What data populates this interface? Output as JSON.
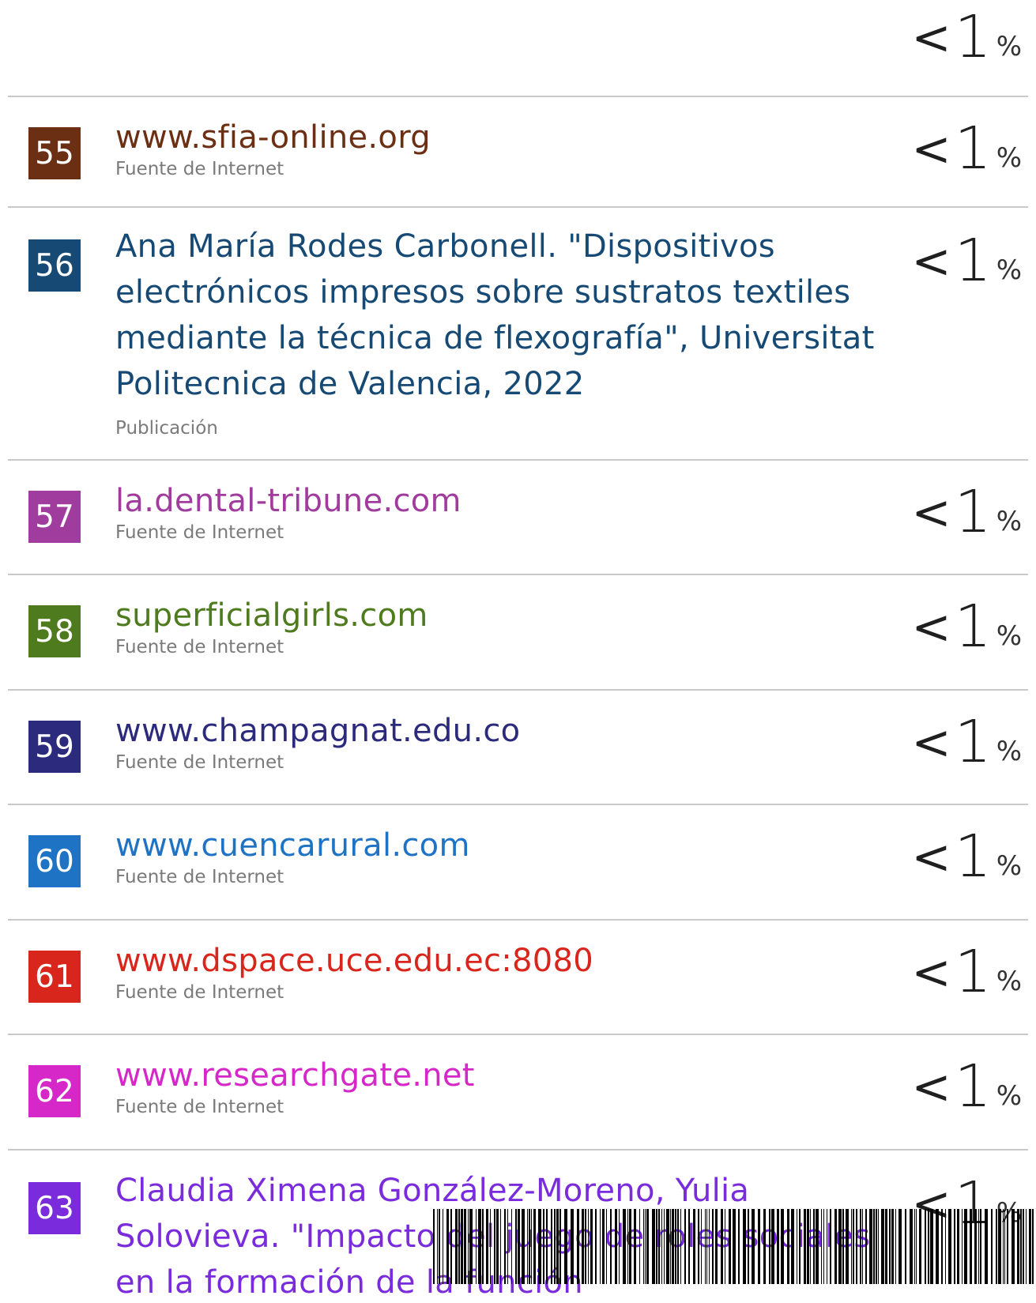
{
  "top_percent": {
    "value": "1",
    "prefix": "<",
    "unit": "%"
  },
  "rows": [
    {
      "num": "55",
      "color": "#6b2f14",
      "title": "www.sfia-online.org",
      "type": "Fuente de Internet",
      "pct": "1"
    },
    {
      "num": "56",
      "color": "#164a74",
      "title": "Ana María Rodes Carbonell. \"Dispositivos electrónicos impresos sobre sustratos textiles mediante la técnica de flexografía\", Universitat Politecnica de Valencia, 2022",
      "type": "Publicación",
      "pct": "1"
    },
    {
      "num": "57",
      "color": "#a03c9d",
      "title": "la.dental-tribune.com",
      "type": "Fuente de Internet",
      "pct": "1"
    },
    {
      "num": "58",
      "color": "#4e7b1e",
      "title": "superficialgirls.com",
      "type": "Fuente de Internet",
      "pct": "1"
    },
    {
      "num": "59",
      "color": "#2c2a7c",
      "title": "www.champagnat.edu.co",
      "type": "Fuente de Internet",
      "pct": "1"
    },
    {
      "num": "60",
      "color": "#1f73c4",
      "title": "www.cuencarural.com",
      "type": "Fuente de Internet",
      "pct": "1"
    },
    {
      "num": "61",
      "color": "#d9261c",
      "title": "www.dspace.uce.edu.ec:8080",
      "type": "Fuente de Internet",
      "pct": "1"
    },
    {
      "num": "62",
      "color": "#d628c8",
      "title": "www.researchgate.net",
      "type": "Fuente de Internet",
      "pct": "1"
    },
    {
      "num": "63",
      "color": "#7a2bdc",
      "title": "Claudia Ximena González-Moreno, Yulia Solovieva. \"Impacto del juego de roles sociales en la formación de la función",
      "type": "",
      "pct": "1"
    }
  ],
  "pct_prefix": "<",
  "pct_unit": "%"
}
